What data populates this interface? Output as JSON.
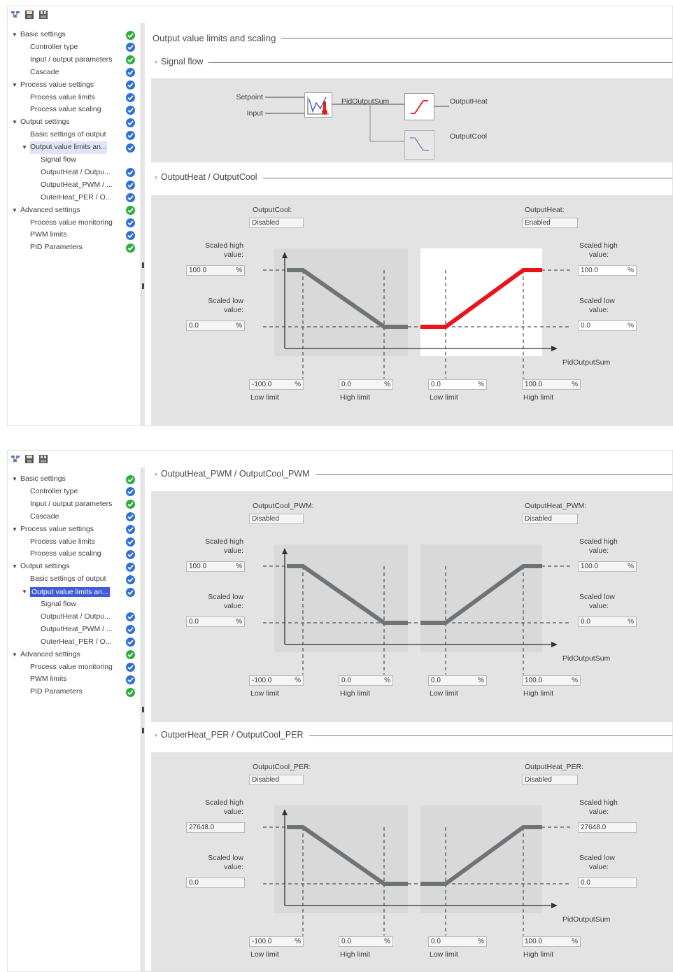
{
  "toolbar": {
    "icons": [
      "network-view-icon",
      "save-icon",
      "save-all-icon"
    ]
  },
  "nav": {
    "items": [
      {
        "label": "Basic settings",
        "level": 0,
        "expandable": true,
        "status": "green"
      },
      {
        "label": "Controller type",
        "level": 1,
        "status": "blue"
      },
      {
        "label": "Input / output parameters",
        "level": 1,
        "status": "green"
      },
      {
        "label": "Cascade",
        "level": 1,
        "status": "blue"
      },
      {
        "label": "Process value settings",
        "level": 0,
        "expandable": true,
        "status": "blue"
      },
      {
        "label": "Process value limits",
        "level": 1,
        "status": "blue"
      },
      {
        "label": "Process value scaling",
        "level": 1,
        "status": "blue"
      },
      {
        "label": "Output settings",
        "level": 0,
        "expandable": true,
        "status": "blue"
      },
      {
        "label": "Basic settings of output",
        "level": 1,
        "status": "blue"
      },
      {
        "label": "Output value limits an...",
        "level": 1,
        "expandable": true,
        "status": "blue"
      },
      {
        "label": "Signal flow",
        "level": 2,
        "status": ""
      },
      {
        "label": "OutputHeat / Outpu...",
        "level": 2,
        "status": "blue"
      },
      {
        "label": "OutputHeat_PWM / ...",
        "level": 2,
        "status": "blue"
      },
      {
        "label": "OuterHeat_PER / O...",
        "level": 2,
        "status": "blue"
      },
      {
        "label": "Advanced settings",
        "level": 0,
        "expandable": true,
        "status": "green"
      },
      {
        "label": "Process value monitoring",
        "level": 1,
        "status": "blue"
      },
      {
        "label": "PWM limits",
        "level": 1,
        "status": "blue"
      },
      {
        "label": "PID Parameters",
        "level": 1,
        "status": "green"
      }
    ]
  },
  "colors": {
    "selection": "#3f5bd8",
    "active_curve": "#e8141a",
    "inactive_curve": "#6e7376",
    "status_green": "#2eac3f",
    "status_blue": "#2f6fd8"
  },
  "pane1": {
    "title": "Output value limits and scaling",
    "signal_flow": {
      "heading": "Signal flow",
      "setpoint": "Setpoint",
      "input": "Input",
      "pid_sum": "PidOutputSum",
      "out_heat": "OutputHeat",
      "out_cool": "OutputCool"
    },
    "section": {
      "heading": "OutputHeat / OutputCool",
      "cool_label": "OutputCool:",
      "cool_value": "Disabled",
      "heat_label": "OutputHeat:",
      "heat_value": "Enabled",
      "scaled_high_l1": "Scaled high",
      "scaled_low_l1": "Scaled low",
      "value_l2": "value:",
      "cool_high": "100.0",
      "cool_low": "0.0",
      "heat_high": "100.0",
      "heat_low": "0.0",
      "pct": "%",
      "x_axis": "PidOutputSum",
      "cool_low_limit": "-100.0",
      "cool_high_limit": "0.0",
      "heat_low_limit": "0.0",
      "heat_high_limit": "100.0",
      "low_limit": "Low limit",
      "high_limit": "High limit"
    }
  },
  "pane2": {
    "pwm": {
      "heading": "OutputHeat_PWM / OutputCool_PWM",
      "cool_label": "OutputCool_PWM:",
      "cool_value": "Disabled",
      "heat_label": "OutputHeat_PWM:",
      "heat_value": "Disabled",
      "scaled_high_l1": "Scaled high",
      "scaled_low_l1": "Scaled low",
      "value_l2": "value:",
      "cool_high": "100.0",
      "cool_low": "0.0",
      "heat_high": "100.0",
      "heat_low": "0.0",
      "pct": "%",
      "x_axis": "PidOutputSum",
      "cool_low_limit": "-100.0",
      "cool_high_limit": "0.0",
      "heat_low_limit": "0.0",
      "heat_high_limit": "100.0",
      "low_limit": "Low limit",
      "high_limit": "High limit"
    },
    "per": {
      "heading": "OutperHeat_PER / OutputCool_PER",
      "cool_label": "OutputCool_PER:",
      "cool_value": "Disabled",
      "heat_label": "OutputHeat_PER:",
      "heat_value": "Disabled",
      "scaled_high_l1": "Scaled high",
      "scaled_low_l1": "Scaled low",
      "value_l2": "value:",
      "cool_high": "27648.0",
      "cool_low": "0.0",
      "heat_high": "27648.0",
      "heat_low": "0.0",
      "pct": "%",
      "x_axis": "PidOutputSum",
      "cool_low_limit": "-100.0",
      "cool_high_limit": "0.0",
      "heat_low_limit": "0.0",
      "heat_high_limit": "100.0",
      "low_limit": "Low limit",
      "high_limit": "High limit"
    }
  }
}
